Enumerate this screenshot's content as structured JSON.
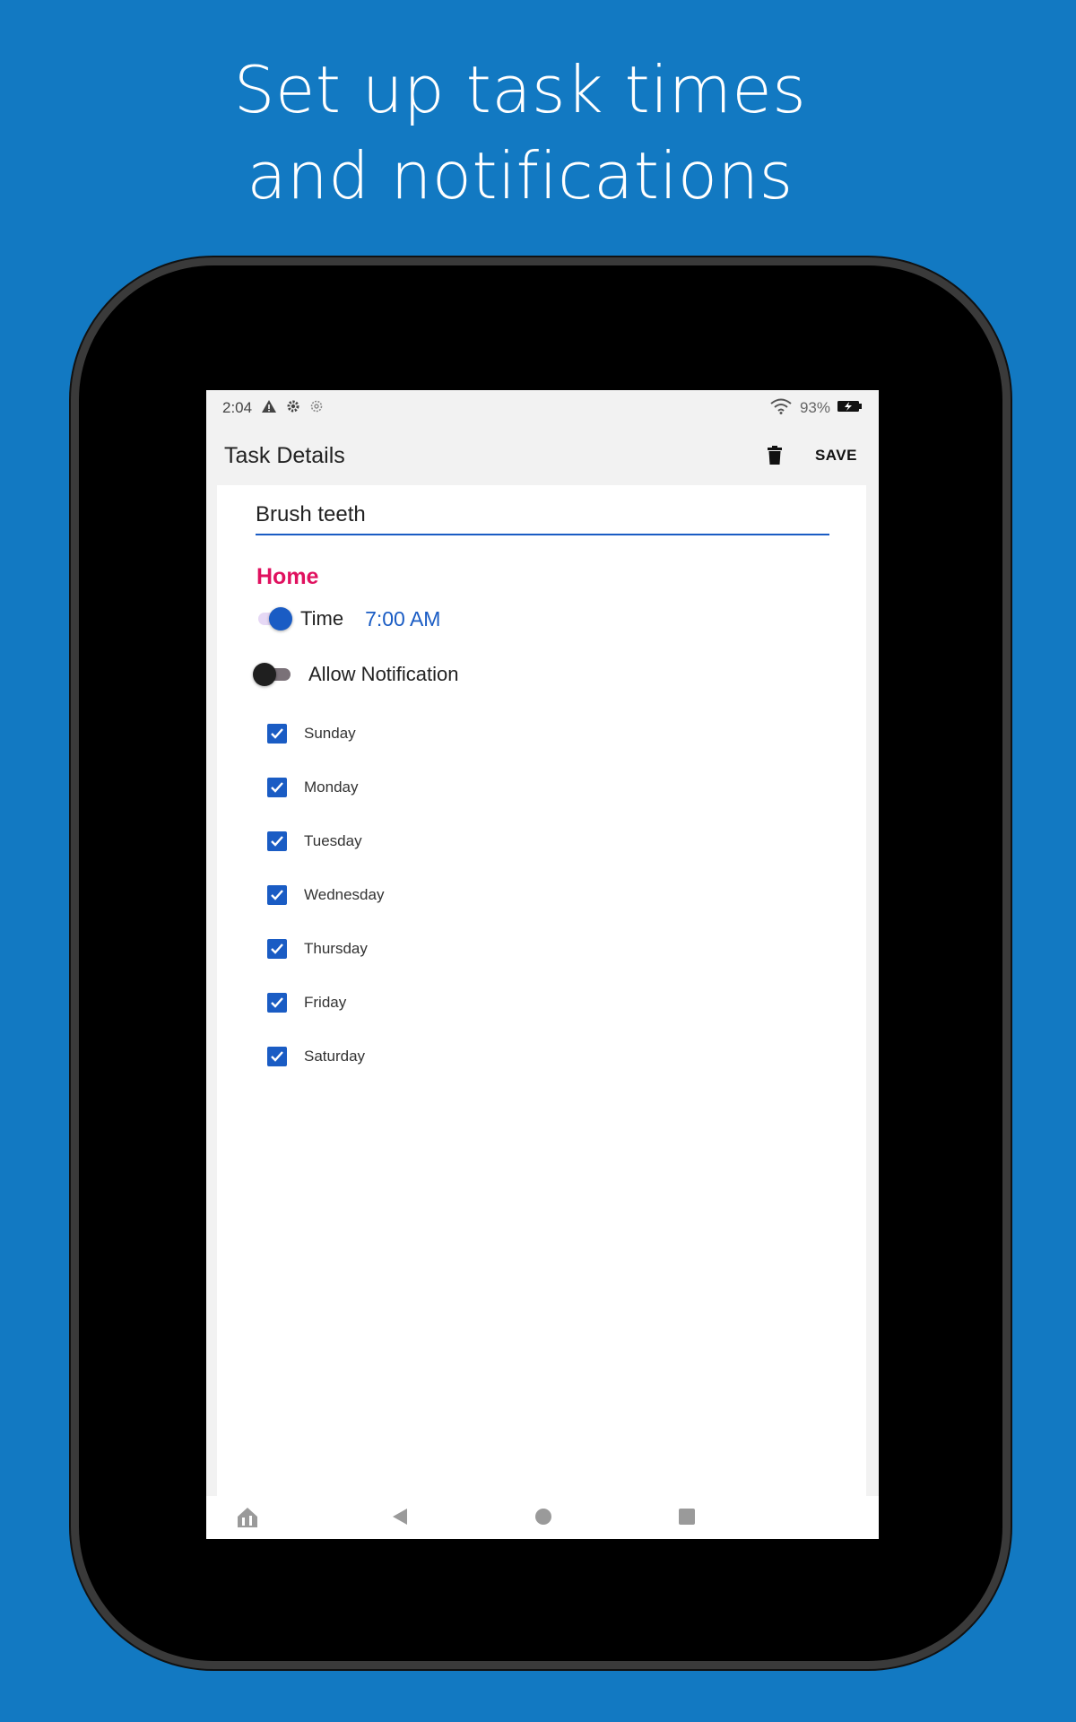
{
  "headline": {
    "line1": "Set up task times",
    "line2": "and notifications"
  },
  "status_bar": {
    "time": "2:04",
    "battery": "93%",
    "icons": [
      "warning-icon",
      "gear-icon",
      "settings-outline-icon",
      "wifi-icon",
      "battery-charging-icon"
    ]
  },
  "app_bar": {
    "title": "Task Details",
    "save_label": "SAVE",
    "delete_icon": "trash-icon"
  },
  "task": {
    "name": "Brush teeth",
    "category": "Home",
    "time_label": "Time",
    "time_value": "7:00 AM",
    "time_enabled": true,
    "notification_label": "Allow Notification",
    "notification_enabled": false
  },
  "days": [
    {
      "label": "Sunday",
      "checked": true
    },
    {
      "label": "Monday",
      "checked": true
    },
    {
      "label": "Tuesday",
      "checked": true
    },
    {
      "label": "Wednesday",
      "checked": true
    },
    {
      "label": "Thursday",
      "checked": true
    },
    {
      "label": "Friday",
      "checked": true
    },
    {
      "label": "Saturday",
      "checked": true
    }
  ],
  "nav_bar": {
    "icons": [
      "app-home-icon",
      "back-icon",
      "home-icon",
      "recents-icon"
    ]
  },
  "colors": {
    "background": "#1279c2",
    "accent": "#1a5cc4",
    "category": "#e0115f"
  }
}
